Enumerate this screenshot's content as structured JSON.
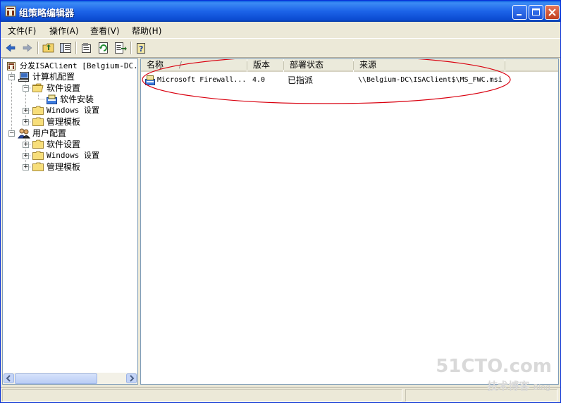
{
  "window": {
    "title": "组策略编辑器"
  },
  "menu": [
    {
      "label": "文件(F)"
    },
    {
      "label": "操作(A)"
    },
    {
      "label": "查看(V)"
    },
    {
      "label": "帮助(H)"
    }
  ],
  "tree": {
    "root": "分发ISAClient [Belgium-DC.zb",
    "computer_config": "计算机配置",
    "cc_software": "软件设置",
    "cc_software_install": "软件安装",
    "cc_windows": "Windows 设置",
    "cc_templates": "管理模板",
    "user_config": "用户配置",
    "uc_software": "软件设置",
    "uc_windows": "Windows 设置",
    "uc_templates": "管理模板"
  },
  "list": {
    "columns": [
      "名称",
      "版本",
      "部署状态",
      "来源"
    ],
    "sort_indicator": "/",
    "rows": [
      {
        "name": "Microsoft Firewall...",
        "version": "4.0",
        "status": "已指派",
        "source": "\\\\Belgium-DC\\ISAClient$\\MS_FWC.msi"
      }
    ]
  },
  "watermark": {
    "line1": "51CTO.com",
    "line2": "技术博客",
    "line3": "Blog"
  },
  "colors": {
    "title_bar": "#0a5ce0",
    "highlight_ellipse": "#d9000f"
  }
}
